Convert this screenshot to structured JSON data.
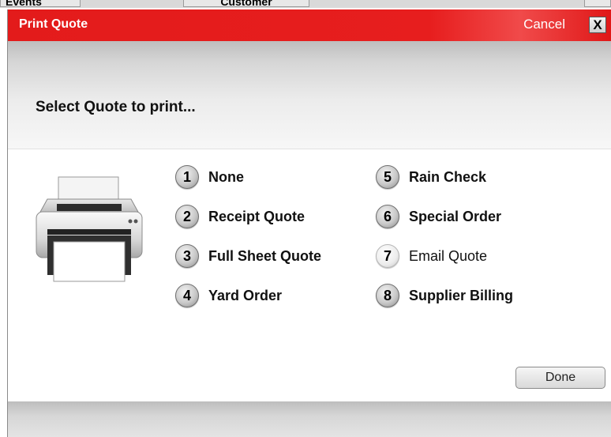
{
  "background": {
    "tabs": [
      "Events",
      "Customer",
      ""
    ]
  },
  "dialog": {
    "title": "Print Quote",
    "cancel_label": "Cancel",
    "close_label": "X",
    "subtitle": "Select Quote to print...",
    "done_label": "Done",
    "options": [
      {
        "number": "1",
        "label": "None"
      },
      {
        "number": "2",
        "label": "Receipt Quote"
      },
      {
        "number": "3",
        "label": "Full Sheet Quote"
      },
      {
        "number": "4",
        "label": "Yard Order"
      },
      {
        "number": "5",
        "label": "Rain Check"
      },
      {
        "number": "6",
        "label": "Special Order"
      },
      {
        "number": "7",
        "label": "Email Quote",
        "state": "disabled"
      },
      {
        "number": "8",
        "label": "Supplier Billing"
      }
    ]
  },
  "colors": {
    "title_bar": "#e31b1b",
    "header_band": "#d6d6d6"
  },
  "icons": [
    "printer-icon",
    "close-icon"
  ]
}
